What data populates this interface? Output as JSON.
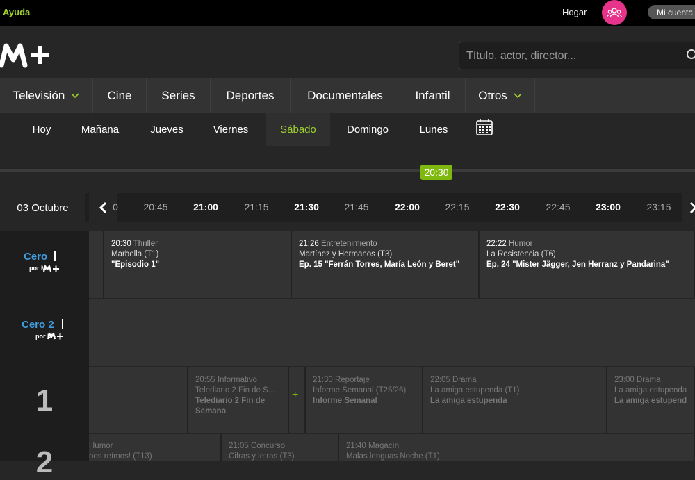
{
  "topbar": {
    "help": "Ayuda",
    "home": "Hogar",
    "account": "Mi cuenta",
    "avatar_icon": "people-icon"
  },
  "brand": {
    "logo_text": "M+",
    "accent": "#9fd22f",
    "pink": "#e7338a"
  },
  "search": {
    "placeholder": "Título, actor, director..."
  },
  "nav": [
    {
      "label": "Televisión",
      "dropdown": true
    },
    {
      "label": "Cine"
    },
    {
      "label": "Series"
    },
    {
      "label": "Deportes"
    },
    {
      "label": "Documentales"
    },
    {
      "label": "Infantil"
    },
    {
      "label": "Otros",
      "dropdown": true
    }
  ],
  "days": [
    "Hoy",
    "Mañana",
    "Jueves",
    "Viernes",
    "Sábado",
    "Domingo",
    "Lunes"
  ],
  "active_day": "Sábado",
  "current_time": "20:30",
  "date": "03 Octubre",
  "ticks": [
    "0",
    "20:45",
    "21:00",
    "21:15",
    "21:30",
    "21:45",
    "22:00",
    "22:15",
    "22:30",
    "22:45",
    "23:00",
    "23:15"
  ],
  "channels": [
    {
      "logo": "Cero",
      "sub": "por M+"
    },
    {
      "logo": "Cero 2",
      "sub": "por M+"
    },
    {
      "number": "1"
    },
    {
      "number": "2"
    }
  ],
  "programs": {
    "cero": [
      {
        "time": "20:30",
        "genre": "Thriller",
        "title": "Marbella (T1)",
        "episode": "\"Episodio 1\""
      },
      {
        "time": "21:26",
        "genre": "Entretenimiento",
        "title": "Martínez y Hermanos (T3)",
        "episode": "Ep. 15 \"Ferrán Torres, María León y Beret\""
      },
      {
        "time": "22:22",
        "genre": "Humor",
        "title": "La Resistencia (T6)",
        "episode": "Ep. 24 \"Mister Jägger, Jen Herranz y Pandarina\""
      }
    ],
    "la1": [
      {
        "time": "20:55",
        "genre": "Informativo",
        "title": "Telediario 2 Fin de S...",
        "episode": "Telediario 2 Fin de Semana"
      },
      {
        "time": "21:30",
        "genre": "Reportaje",
        "title": "Informe Semanal (T25/26)",
        "episode": "Informe Semanal"
      },
      {
        "time": "22:05",
        "genre": "Drama",
        "title": "La amiga estupenda (T1)",
        "episode": "La amiga estupenda"
      },
      {
        "time": "23:00",
        "genre": "Drama",
        "title": "La amiga estupenda (T",
        "episode": "La amiga estupenda"
      }
    ],
    "la2": [
      {
        "genre": "Humor",
        "title": "nos reímos! (T13)"
      },
      {
        "time": "21:05",
        "genre": "Concurso",
        "title": "Cifras y letras (T3)"
      },
      {
        "time": "21:40",
        "genre": "Magacín",
        "title": "Malas lenguas Noche (T1)"
      }
    ]
  }
}
